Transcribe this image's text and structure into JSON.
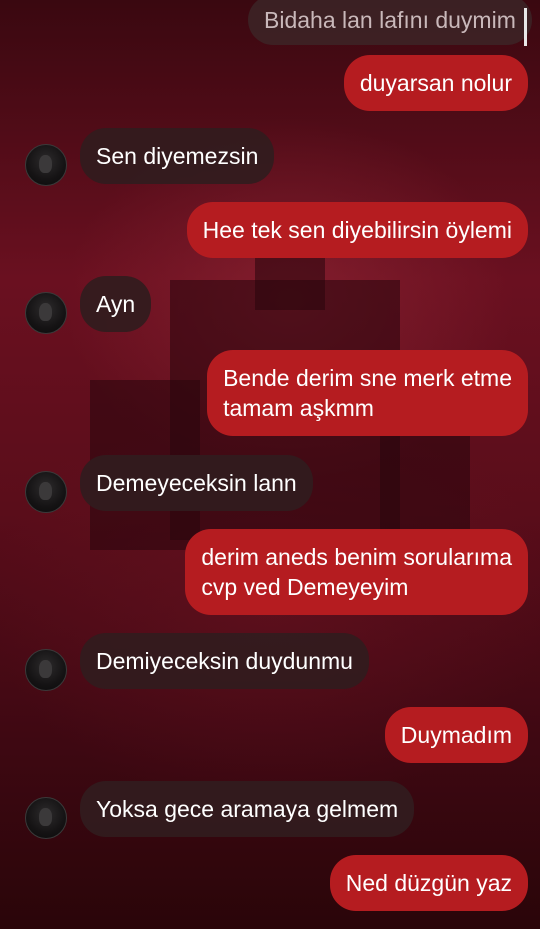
{
  "messages": [
    {
      "dir": "in",
      "text": "Bidaha lan lafını duymim",
      "avatar": false
    },
    {
      "dir": "out",
      "text": "duyarsan nolur"
    },
    {
      "dir": "in",
      "text": "Sen diyemezsin",
      "avatar": true
    },
    {
      "dir": "out",
      "text": "Hee tek sen diyebilirsin öylemi"
    },
    {
      "dir": "in",
      "text": "Ayn",
      "avatar": true
    },
    {
      "dir": "out",
      "text": "Bende derim sne merk etme\ntamam aşkmm"
    },
    {
      "dir": "in",
      "text": "Demeyeceksin lann",
      "avatar": true
    },
    {
      "dir": "out",
      "text": "derim aneds benim sorularıma\ncvp ved Demeyeyim"
    },
    {
      "dir": "in",
      "text": "Demiyeceksin duydunmu",
      "avatar": true
    },
    {
      "dir": "out",
      "text": "Duymadım"
    },
    {
      "dir": "in",
      "text": "Yoksa gece aramaya gelmem",
      "avatar": true
    },
    {
      "dir": "out",
      "text": "Ned düzgün yaz"
    }
  ],
  "colors": {
    "outgoing_bubble": "#b51c20",
    "incoming_bubble": "#321c1e",
    "background": "#5a0d1a"
  },
  "icons": {
    "avatar": "user-avatar-icon"
  }
}
